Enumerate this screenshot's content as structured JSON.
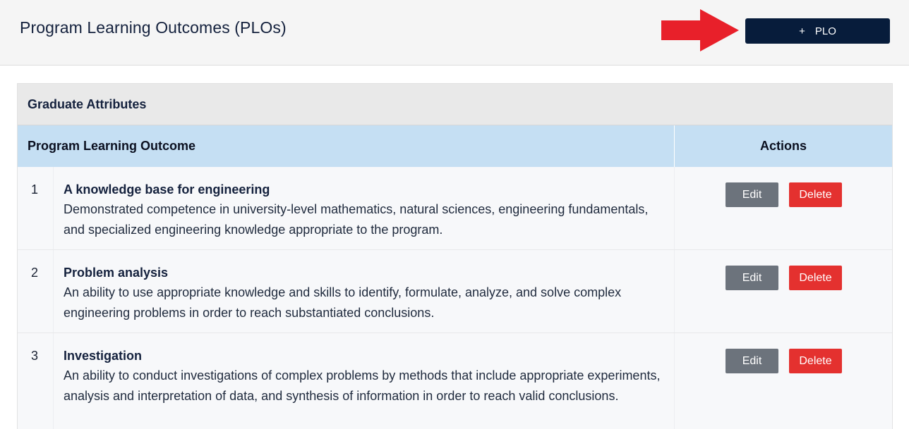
{
  "header": {
    "title": "Program Learning Outcomes (PLOs)",
    "add_button": {
      "icon": "+",
      "label": "PLO"
    },
    "arrow_color": "#e8202a"
  },
  "card": {
    "section_title": "Graduate Attributes",
    "columns": {
      "outcome": "Program Learning Outcome",
      "actions": "Actions"
    },
    "rows": [
      {
        "number": "1",
        "title": "A knowledge base for engineering",
        "description": "Demonstrated competence in university-level mathematics, natural sciences, engineering fundamentals, and specialized engineering knowledge appropriate to the program.",
        "edit_label": "Edit",
        "delete_label": "Delete"
      },
      {
        "number": "2",
        "title": "Problem analysis",
        "description": "An ability to use appropriate knowledge and skills to identify, formulate, analyze, and solve complex engineering problems in order to reach substantiated conclusions.",
        "edit_label": "Edit",
        "delete_label": "Delete"
      },
      {
        "number": "3",
        "title": "Investigation",
        "description": "An ability to conduct investigations of complex problems by methods that include appropriate experiments, analysis and interpretation of data, and synthesis of information in order to reach valid conclusions.",
        "edit_label": "Edit",
        "delete_label": "Delete"
      }
    ]
  },
  "colors": {
    "primary": "#071c3b",
    "edit": "#6c737c",
    "delete": "#e4312f",
    "column_header": "#c5dff3"
  }
}
